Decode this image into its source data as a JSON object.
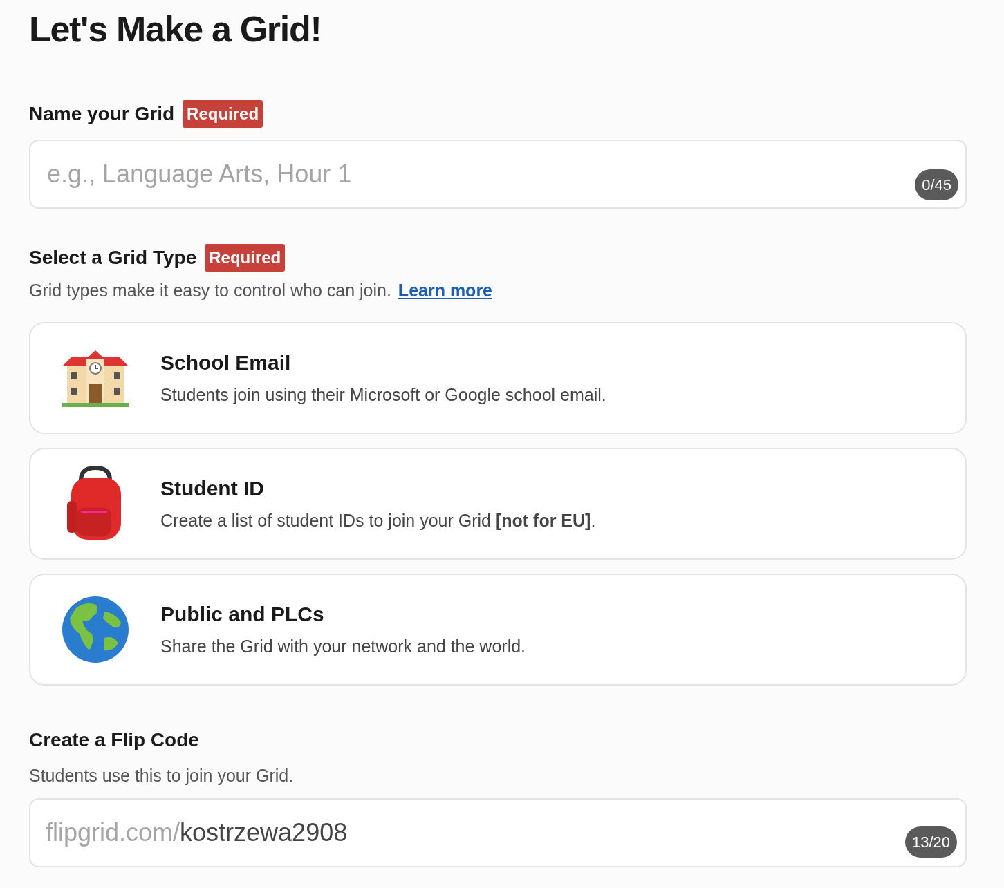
{
  "title": "Let's Make a Grid!",
  "name_section": {
    "label": "Name your Grid",
    "badge": "Required",
    "placeholder": "e.g., Language Arts, Hour 1",
    "counter": "0/45"
  },
  "type_section": {
    "label": "Select a Grid Type",
    "badge": "Required",
    "help": "Grid types make it easy to control who can join.",
    "link": "Learn more",
    "options": [
      {
        "kind": "school",
        "title": "School Email",
        "description": "Students join using their Microsoft or Google school email."
      },
      {
        "kind": "backpack",
        "title": "Student ID",
        "description": "Create a list of student IDs to join your Grid **[not for EU]**."
      },
      {
        "kind": "globe",
        "title": "Public and PLCs",
        "description": "Share the Grid with your network and the world."
      }
    ]
  },
  "code_section": {
    "label": "Create a Flip Code",
    "help": "Students use this to join your Grid.",
    "prefix": "flipgrid.com/",
    "value": "kostrzewa2908",
    "counter": "13/20"
  }
}
